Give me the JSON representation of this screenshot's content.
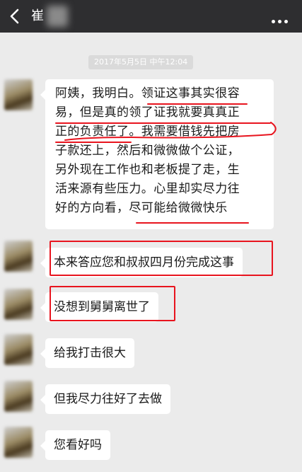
{
  "header": {
    "back_icon": "chevron-left-icon",
    "contact_name": "崔",
    "more_icon": "more-dots-icon"
  },
  "timestamp": "2017年5月5日 中午12:04",
  "messages": [
    {
      "lines": [
        "阿姨，我明白。领证这事其实很容",
        "易，但是真的领了证我就要真真正",
        "正的负责任了。我需要借钱先把房",
        "子款还上，然后和微微做个公证，",
        "另外现在工作也和老板提了走，生",
        "活来源有些压力。心里却实尽力往",
        "好的方向看，尽可能给微微快乐"
      ]
    },
    {
      "text": "本来答应您和叔叔四月份完成这事"
    },
    {
      "text": "没想到舅舅离世了"
    },
    {
      "text": "给我打击很大"
    },
    {
      "text": "但我尽力往好了去做"
    },
    {
      "text": "您看好吗"
    }
  ],
  "colors": {
    "title_bar": "#2e2e30",
    "chat_background": "#ebebeb",
    "annotation_red": "#e8141e"
  }
}
